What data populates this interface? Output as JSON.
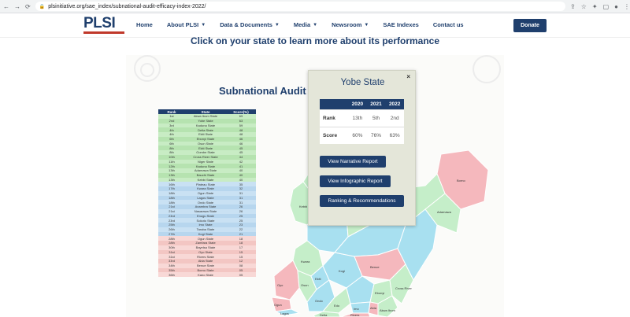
{
  "browser": {
    "url": "plsinitiative.org/sae_index/subnational-audit-efficacy-index-2022/"
  },
  "header": {
    "logo_text": "PLSI",
    "nav": [
      {
        "label": "Home",
        "dropdown": false
      },
      {
        "label": "About PLSI",
        "dropdown": true
      },
      {
        "label": "Data & Documents",
        "dropdown": true
      },
      {
        "label": "Media",
        "dropdown": true
      },
      {
        "label": "Newsroom",
        "dropdown": true
      },
      {
        "label": "SAE Indexes",
        "dropdown": false
      },
      {
        "label": "Contact us",
        "dropdown": false
      }
    ],
    "donate_label": "Donate"
  },
  "page": {
    "heading": "Click on your state to learn more about its performance"
  },
  "infographic": {
    "title": "Subnational Audit",
    "table_headers": [
      "Rank",
      "State",
      "Score(%)"
    ],
    "rows": [
      {
        "rank": "1st",
        "state": "Akwa Ibom State",
        "score": "69",
        "band": "green"
      },
      {
        "rank": "2nd",
        "state": "Yobe State",
        "score": "63",
        "band": "green2"
      },
      {
        "rank": "3rd",
        "state": "Kaduna State",
        "score": "59",
        "band": "green"
      },
      {
        "rank": "4th",
        "state": "Delta State",
        "score": "48",
        "band": "green2"
      },
      {
        "rank": "4th",
        "state": "Ekiti State",
        "score": "48",
        "band": "green"
      },
      {
        "rank": "6th",
        "state": "Ebonyi State",
        "score": "46",
        "band": "green2"
      },
      {
        "rank": "6th",
        "state": "Osun State",
        "score": "46",
        "band": "green"
      },
      {
        "rank": "8th",
        "state": "Ekiti State",
        "score": "45",
        "band": "green2"
      },
      {
        "rank": "8th",
        "state": "Gombe State",
        "score": "45",
        "band": "green"
      },
      {
        "rank": "10th",
        "state": "Cross River State",
        "score": "44",
        "band": "green2"
      },
      {
        "rank": "11th",
        "state": "Niger State",
        "score": "42",
        "band": "green"
      },
      {
        "rank": "12th",
        "state": "Kaduna State",
        "score": "41",
        "band": "green2"
      },
      {
        "rank": "13th",
        "state": "Adamawa State",
        "score": "40",
        "band": "green"
      },
      {
        "rank": "13th",
        "state": "Bauchi State",
        "score": "40",
        "band": "green2"
      },
      {
        "rank": "13th",
        "state": "Kebbi State",
        "score": "40",
        "band": "green"
      },
      {
        "rank": "16th",
        "state": "Plateau State",
        "score": "35",
        "band": "blue"
      },
      {
        "rank": "17th",
        "state": "Kwara State",
        "score": "32",
        "band": "blue2"
      },
      {
        "rank": "18th",
        "state": "Ogun State",
        "score": "31",
        "band": "blue"
      },
      {
        "rank": "18th",
        "state": "Lagos State",
        "score": "31",
        "band": "blue2"
      },
      {
        "rank": "18th",
        "state": "Ondo State",
        "score": "31",
        "band": "blue"
      },
      {
        "rank": "21st",
        "state": "Anambra State",
        "score": "26",
        "band": "blue2"
      },
      {
        "rank": "21st",
        "state": "Nasarawa State",
        "score": "26",
        "band": "blue"
      },
      {
        "rank": "23rd",
        "state": "Enugu State",
        "score": "25",
        "band": "blue2"
      },
      {
        "rank": "23rd",
        "state": "Sokoto State",
        "score": "25",
        "band": "blue"
      },
      {
        "rank": "25th",
        "state": "Imo State",
        "score": "23",
        "band": "blue2"
      },
      {
        "rank": "26th",
        "state": "Taraba State",
        "score": "22",
        "band": "blue"
      },
      {
        "rank": "27th",
        "state": "Kogi State",
        "score": "21",
        "band": "blue2"
      },
      {
        "rank": "28th",
        "state": "Ogun State",
        "score": "18",
        "band": "pink"
      },
      {
        "rank": "28th",
        "state": "Zamfara State",
        "score": "18",
        "band": "pink2"
      },
      {
        "rank": "30th",
        "state": "Bayelsa State",
        "score": "17",
        "band": "pink"
      },
      {
        "rank": "31st",
        "state": "Oyo State",
        "score": "15",
        "band": "pink2"
      },
      {
        "rank": "31st",
        "state": "Rivers State",
        "score": "15",
        "band": "pink"
      },
      {
        "rank": "33rd",
        "state": "Abia State",
        "score": "12",
        "band": "pink2"
      },
      {
        "rank": "34th",
        "state": "Benue State",
        "score": "08",
        "band": "pink"
      },
      {
        "rank": "35th",
        "state": "Borno State",
        "score": "05",
        "band": "pink2"
      },
      {
        "rank": "36th",
        "state": "Kano State",
        "score": "05",
        "band": "pink"
      }
    ],
    "map_labels": {
      "kebbi": "Kebbi",
      "kwara": "Kwara",
      "oyo": "Oyo",
      "ogun": "Ogun",
      "lagos": "Lagos",
      "osun": "Osun",
      "ondo": "Ondo",
      "ekiti": "Ekiti",
      "kogi": "Kogi",
      "benue": "Benue",
      "borno": "Borno",
      "adamawa": "Adamawa",
      "delta": "Delta",
      "edo": "Edo",
      "bayelsa": "Bayelsa",
      "rivers": "Rivers",
      "ebonyi": "Ebonyi",
      "abia": "Abia",
      "imo": "Imo",
      "cross_river": "Cross River",
      "akwa_ibom": "Akwa Ibom"
    }
  },
  "popup": {
    "title": "Yobe State",
    "close": "×",
    "years": [
      "2020",
      "2021",
      "2022"
    ],
    "rank_label": "Rank",
    "rank": [
      "13th",
      "5th",
      "2nd"
    ],
    "score_label": "Score",
    "score": [
      "60%",
      "76%",
      "63%"
    ],
    "buttons": {
      "narrative": "View Narrative Report",
      "infographic": "View Infographic Report",
      "ranking": "Ranking & Recommendations"
    }
  },
  "colors": {
    "brand_navy": "#1f3f6d",
    "brand_red": "#c0392b",
    "map_green": "#c5eec9",
    "map_blue": "#a8e0f0",
    "map_pink": "#f5b8bd"
  }
}
